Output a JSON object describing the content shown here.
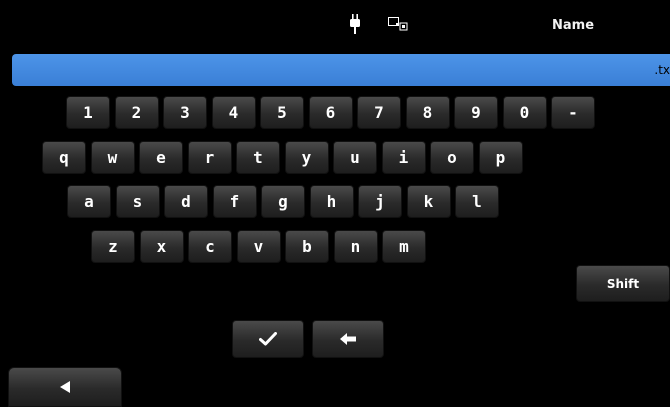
{
  "header": {
    "title": "Name",
    "icons": [
      "power-plug-icon",
      "network-icon"
    ]
  },
  "name_field": {
    "value": ".tx"
  },
  "keyboard": {
    "row1": [
      "1",
      "2",
      "3",
      "4",
      "5",
      "6",
      "7",
      "8",
      "9",
      "0",
      "-"
    ],
    "row2": [
      "q",
      "w",
      "e",
      "r",
      "t",
      "y",
      "u",
      "i",
      "o",
      "p"
    ],
    "row3": [
      "a",
      "s",
      "d",
      "f",
      "g",
      "h",
      "j",
      "k",
      "l"
    ],
    "row4": [
      "z",
      "x",
      "c",
      "v",
      "b",
      "n",
      "m"
    ],
    "shift_label": "Shift"
  },
  "actions": {
    "enter_icon": "checkmark-icon",
    "backspace_icon": "left-arrow-icon",
    "back_icon": "left-triangle-icon"
  }
}
